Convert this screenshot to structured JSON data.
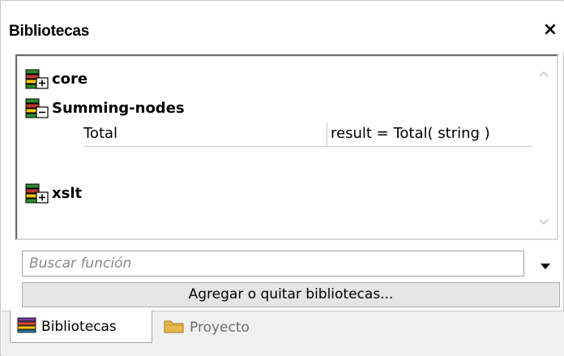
{
  "window": {
    "title": "Bibliotecas",
    "close_glyph": "×"
  },
  "libraries": [
    {
      "name": "core",
      "icon": "library-expand-icon",
      "expanded": false
    },
    {
      "name": "Summing-nodes",
      "icon": "library-collapse-icon",
      "expanded": true,
      "functions": [
        {
          "name": "Total",
          "signature": "result = Total( string )"
        }
      ]
    },
    {
      "name": "xslt",
      "icon": "library-expand-icon",
      "expanded": false
    }
  ],
  "search": {
    "placeholder": "Buscar función",
    "value": ""
  },
  "add_button_label": "Agregar o quitar bibliotecas...",
  "tabs": [
    {
      "label": "Bibliotecas",
      "icon": "books-icon",
      "active": true
    },
    {
      "label": "Proyecto",
      "icon": "folder-icon",
      "active": false
    }
  ],
  "colors": {
    "border_dark": "#6a6a6a",
    "button_bg": "#e5e5e5",
    "tab_strip_bg": "#f0f0f0"
  }
}
